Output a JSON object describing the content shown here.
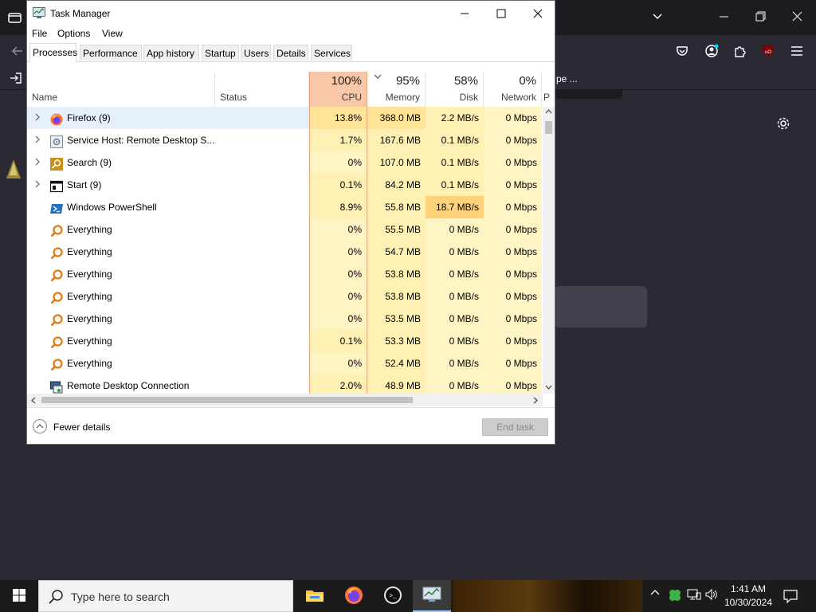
{
  "window": {
    "title": "Task Manager",
    "menu": [
      "File",
      "Options",
      "View"
    ],
    "tabs": [
      "Processes",
      "Performance",
      "App history",
      "Startup",
      "Users",
      "Details",
      "Services"
    ],
    "active_tab": "Processes"
  },
  "columns": {
    "name": "Name",
    "status": "Status",
    "cpu": {
      "pct": "100%",
      "label": "CPU"
    },
    "memory": {
      "pct": "95%",
      "label": "Memory"
    },
    "disk": {
      "pct": "58%",
      "label": "Disk"
    },
    "network": {
      "pct": "0%",
      "label": "Network"
    },
    "more": "P"
  },
  "processes": [
    {
      "name": "Firefox (9)",
      "icon": "firefox-icon",
      "expandable": true,
      "cpu": "13.8%",
      "memory": "368.0 MB",
      "disk": "2.2 MB/s",
      "network": "0 Mbps",
      "cpu_heat": 2,
      "mem_heat": 2,
      "disk_heat": 1
    },
    {
      "name": "Service Host: Remote Desktop S...",
      "icon": "service-host-icon",
      "expandable": true,
      "cpu": "1.7%",
      "memory": "167.6 MB",
      "disk": "0.1 MB/s",
      "network": "0 Mbps",
      "cpu_heat": 1,
      "mem_heat": 1,
      "disk_heat": 1
    },
    {
      "name": "Search (9)",
      "icon": "search-app-icon",
      "expandable": true,
      "cpu": "0%",
      "memory": "107.0 MB",
      "disk": "0.1 MB/s",
      "network": "0 Mbps",
      "cpu_heat": 0,
      "mem_heat": 1,
      "disk_heat": 1
    },
    {
      "name": "Start (9)",
      "icon": "start-app-icon",
      "expandable": true,
      "cpu": "0.1%",
      "memory": "84.2 MB",
      "disk": "0.1 MB/s",
      "network": "0 Mbps",
      "cpu_heat": 1,
      "mem_heat": 1,
      "disk_heat": 1
    },
    {
      "name": "Windows PowerShell",
      "icon": "powershell-icon",
      "expandable": false,
      "cpu": "8.9%",
      "memory": "55.8 MB",
      "disk": "18.7 MB/s",
      "network": "0 Mbps",
      "cpu_heat": 1,
      "mem_heat": 1,
      "disk_heat": 3
    },
    {
      "name": "Everything",
      "icon": "everything-icon",
      "expandable": false,
      "cpu": "0%",
      "memory": "55.5 MB",
      "disk": "0 MB/s",
      "network": "0 Mbps",
      "cpu_heat": 0,
      "mem_heat": 1,
      "disk_heat": 0
    },
    {
      "name": "Everything",
      "icon": "everything-icon",
      "expandable": false,
      "cpu": "0%",
      "memory": "54.7 MB",
      "disk": "0 MB/s",
      "network": "0 Mbps",
      "cpu_heat": 0,
      "mem_heat": 1,
      "disk_heat": 0
    },
    {
      "name": "Everything",
      "icon": "everything-icon",
      "expandable": false,
      "cpu": "0%",
      "memory": "53.8 MB",
      "disk": "0 MB/s",
      "network": "0 Mbps",
      "cpu_heat": 0,
      "mem_heat": 1,
      "disk_heat": 0
    },
    {
      "name": "Everything",
      "icon": "everything-icon",
      "expandable": false,
      "cpu": "0%",
      "memory": "53.8 MB",
      "disk": "0 MB/s",
      "network": "0 Mbps",
      "cpu_heat": 0,
      "mem_heat": 1,
      "disk_heat": 0
    },
    {
      "name": "Everything",
      "icon": "everything-icon",
      "expandable": false,
      "cpu": "0%",
      "memory": "53.5 MB",
      "disk": "0 MB/s",
      "network": "0 Mbps",
      "cpu_heat": 0,
      "mem_heat": 1,
      "disk_heat": 0
    },
    {
      "name": "Everything",
      "icon": "everything-icon",
      "expandable": false,
      "cpu": "0.1%",
      "memory": "53.3 MB",
      "disk": "0 MB/s",
      "network": "0 Mbps",
      "cpu_heat": 1,
      "mem_heat": 1,
      "disk_heat": 0
    },
    {
      "name": "Everything",
      "icon": "everything-icon",
      "expandable": false,
      "cpu": "0%",
      "memory": "52.4 MB",
      "disk": "0 MB/s",
      "network": "0 Mbps",
      "cpu_heat": 0,
      "mem_heat": 1,
      "disk_heat": 0
    },
    {
      "name": "Remote Desktop Connection",
      "icon": "remote-desktop-icon",
      "expandable": false,
      "cpu": "2.0%",
      "memory": "48.9 MB",
      "disk": "0 MB/s",
      "network": "0 Mbps",
      "cpu_heat": 1,
      "mem_heat": 1,
      "disk_heat": 0
    }
  ],
  "footer": {
    "fewer_details": "Fewer details",
    "end_task": "End task"
  },
  "firefox_bg": {
    "bookmark_text": "pe ..."
  },
  "taskbar": {
    "search_placeholder": "Type here to search",
    "time": "1:41 AM",
    "date": "10/30/2024"
  },
  "colors": {
    "heat0": "#fff4c4",
    "heat1": "#fff0b3",
    "heat2": "#ffe497",
    "heat3": "#ffd27a",
    "selected": "#e5f0fb"
  }
}
